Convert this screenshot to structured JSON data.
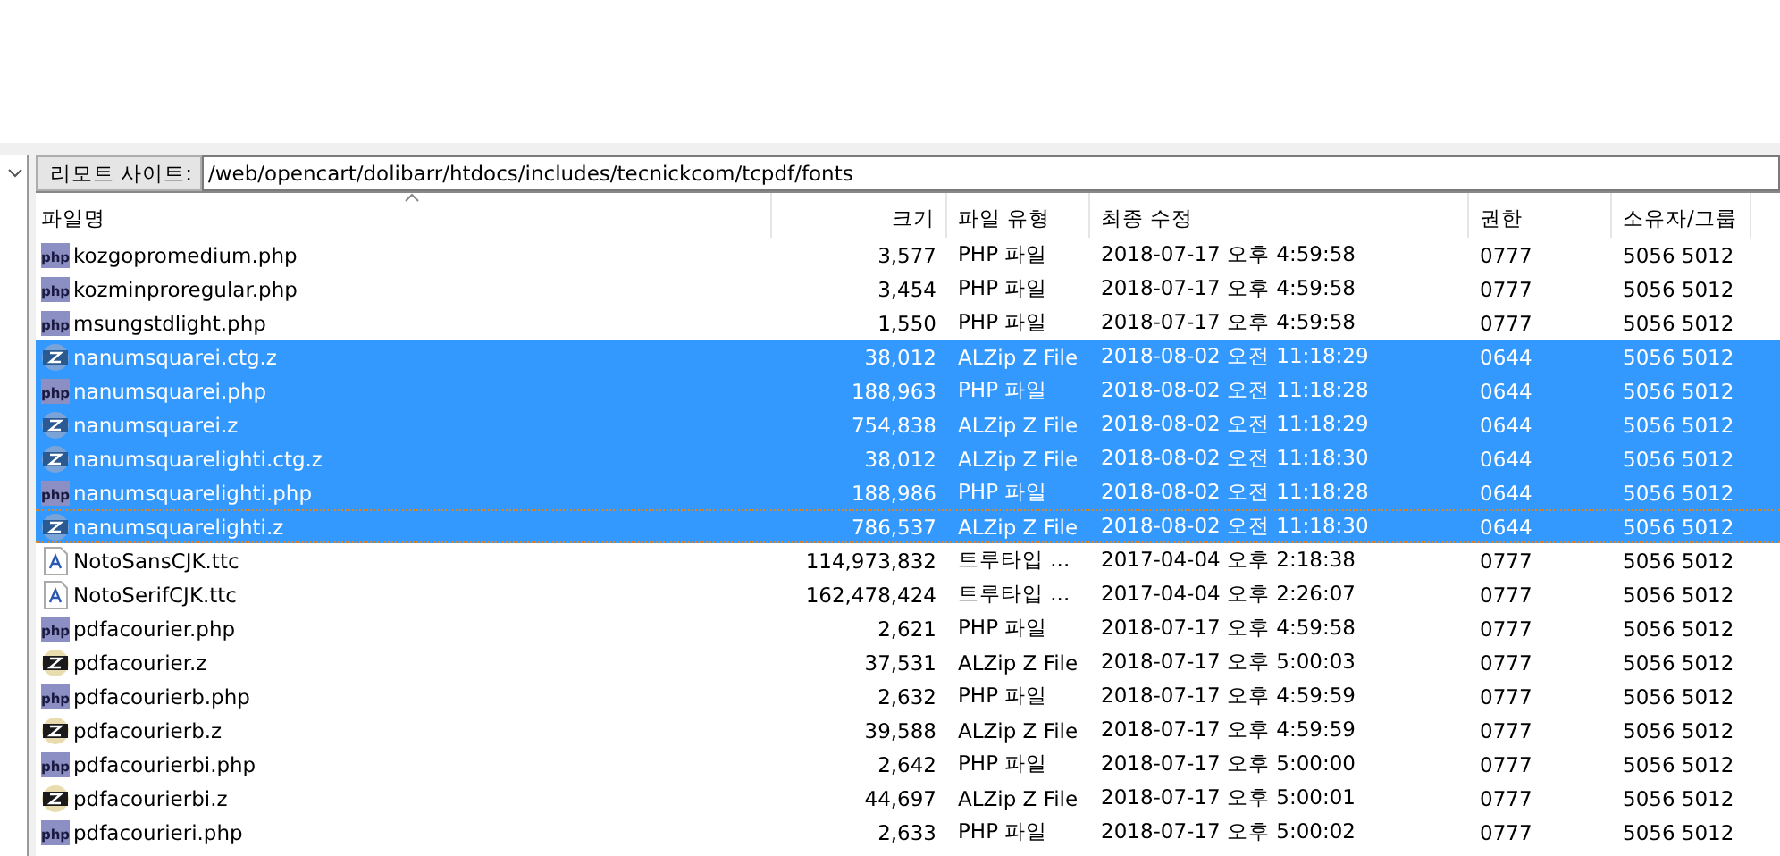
{
  "remote_site": {
    "label": "리모트 사이트:",
    "path": "/web/opencart/dolibarr/htdocs/includes/tecnickcom/tcpdf/fonts"
  },
  "table": {
    "columns": [
      {
        "label": "파일명",
        "sorted": true
      },
      {
        "label": "크기",
        "sorted": false
      },
      {
        "label": "파일 유형",
        "sorted": false
      },
      {
        "label": "최종 수정",
        "sorted": false
      },
      {
        "label": "권한",
        "sorted": false
      },
      {
        "label": "소유자/그룹",
        "sorted": false
      }
    ],
    "rows": [
      {
        "kind": "php",
        "name": "kozgopromedium.php",
        "size": "3,577",
        "type": "PHP 파일",
        "modified": "2018-07-17 오후 4:59:58",
        "perm": "0777",
        "owner": "5056 5012",
        "selected": false,
        "focused": false
      },
      {
        "kind": "php",
        "name": "kozminproregular.php",
        "size": "3,454",
        "type": "PHP 파일",
        "modified": "2018-07-17 오후 4:59:58",
        "perm": "0777",
        "owner": "5056 5012",
        "selected": false,
        "focused": false
      },
      {
        "kind": "php",
        "name": "msungstdlight.php",
        "size": "1,550",
        "type": "PHP 파일",
        "modified": "2018-07-17 오후 4:59:58",
        "perm": "0777",
        "owner": "5056 5012",
        "selected": false,
        "focused": false
      },
      {
        "kind": "zip",
        "name": "nanumsquarei.ctg.z",
        "size": "38,012",
        "type": "ALZip Z File",
        "modified": "2018-08-02 오전 11:18:29",
        "perm": "0644",
        "owner": "5056 5012",
        "selected": true,
        "focused": false
      },
      {
        "kind": "php",
        "name": "nanumsquarei.php",
        "size": "188,963",
        "type": "PHP 파일",
        "modified": "2018-08-02 오전 11:18:28",
        "perm": "0644",
        "owner": "5056 5012",
        "selected": true,
        "focused": false
      },
      {
        "kind": "zip",
        "name": "nanumsquarei.z",
        "size": "754,838",
        "type": "ALZip Z File",
        "modified": "2018-08-02 오전 11:18:29",
        "perm": "0644",
        "owner": "5056 5012",
        "selected": true,
        "focused": false
      },
      {
        "kind": "zip",
        "name": "nanumsquarelighti.ctg.z",
        "size": "38,012",
        "type": "ALZip Z File",
        "modified": "2018-08-02 오전 11:18:30",
        "perm": "0644",
        "owner": "5056 5012",
        "selected": true,
        "focused": false
      },
      {
        "kind": "php",
        "name": "nanumsquarelighti.php",
        "size": "188,986",
        "type": "PHP 파일",
        "modified": "2018-08-02 오전 11:18:28",
        "perm": "0644",
        "owner": "5056 5012",
        "selected": true,
        "focused": false
      },
      {
        "kind": "zip",
        "name": "nanumsquarelighti.z",
        "size": "786,537",
        "type": "ALZip Z File",
        "modified": "2018-08-02 오전 11:18:30",
        "perm": "0644",
        "owner": "5056 5012",
        "selected": true,
        "focused": true
      },
      {
        "kind": "font",
        "name": "NotoSansCJK.ttc",
        "size": "114,973,832",
        "type": "트루타입 ...",
        "modified": "2017-04-04 오후 2:18:38",
        "perm": "0777",
        "owner": "5056 5012",
        "selected": false,
        "focused": false
      },
      {
        "kind": "font",
        "name": "NotoSerifCJK.ttc",
        "size": "162,478,424",
        "type": "트루타입 ...",
        "modified": "2017-04-04 오후 2:26:07",
        "perm": "0777",
        "owner": "5056 5012",
        "selected": false,
        "focused": false
      },
      {
        "kind": "php",
        "name": "pdfacourier.php",
        "size": "2,621",
        "type": "PHP 파일",
        "modified": "2018-07-17 오후 4:59:58",
        "perm": "0777",
        "owner": "5056 5012",
        "selected": false,
        "focused": false
      },
      {
        "kind": "zip",
        "name": "pdfacourier.z",
        "size": "37,531",
        "type": "ALZip Z File",
        "modified": "2018-07-17 오후 5:00:03",
        "perm": "0777",
        "owner": "5056 5012",
        "selected": false,
        "focused": false
      },
      {
        "kind": "php",
        "name": "pdfacourierb.php",
        "size": "2,632",
        "type": "PHP 파일",
        "modified": "2018-07-17 오후 4:59:59",
        "perm": "0777",
        "owner": "5056 5012",
        "selected": false,
        "focused": false
      },
      {
        "kind": "zip",
        "name": "pdfacourierb.z",
        "size": "39,588",
        "type": "ALZip Z File",
        "modified": "2018-07-17 오후 4:59:59",
        "perm": "0777",
        "owner": "5056 5012",
        "selected": false,
        "focused": false
      },
      {
        "kind": "php",
        "name": "pdfacourierbi.php",
        "size": "2,642",
        "type": "PHP 파일",
        "modified": "2018-07-17 오후 5:00:00",
        "perm": "0777",
        "owner": "5056 5012",
        "selected": false,
        "focused": false
      },
      {
        "kind": "zip",
        "name": "pdfacourierbi.z",
        "size": "44,697",
        "type": "ALZip Z File",
        "modified": "2018-07-17 오후 5:00:01",
        "perm": "0777",
        "owner": "5056 5012",
        "selected": false,
        "focused": false
      },
      {
        "kind": "php",
        "name": "pdfacourieri.php",
        "size": "2,633",
        "type": "PHP 파일",
        "modified": "2018-07-17 오후 5:00:02",
        "perm": "0777",
        "owner": "5056 5012",
        "selected": false,
        "focused": false
      }
    ]
  }
}
